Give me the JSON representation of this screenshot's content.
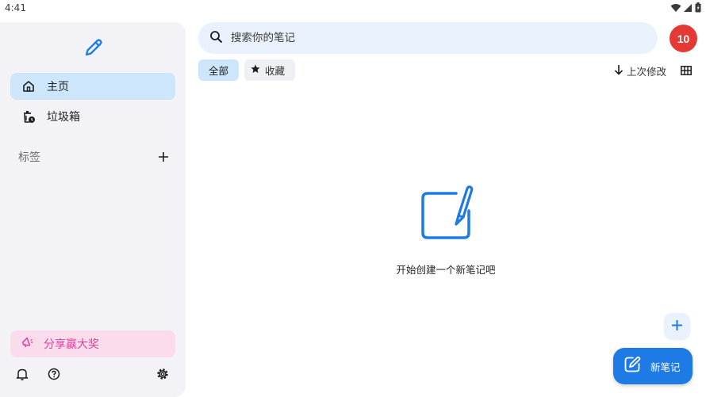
{
  "status_bar": {
    "time": "4:41"
  },
  "sidebar": {
    "nav": [
      {
        "label": "主页",
        "icon": "home-icon",
        "active": true
      },
      {
        "label": "垃圾箱",
        "icon": "trash-icon",
        "active": false
      }
    ],
    "tags_label": "标签",
    "promo_label": "分享赢大奖",
    "bottom_icons": [
      "bell-icon",
      "help-icon",
      "gear-icon"
    ]
  },
  "search": {
    "placeholder": "搜索你的笔记"
  },
  "badge": {
    "count": "10"
  },
  "filters": {
    "all_label": "全部",
    "favorites_label": "收藏"
  },
  "sort": {
    "label": "上次修改"
  },
  "empty_state": {
    "text": "开始创建一个新笔记吧"
  },
  "fab": {
    "new_note_label": "新笔记"
  },
  "colors": {
    "accent": "#1e7be6",
    "active_nav": "#cde6fb",
    "badge": "#e53935",
    "promo_bg": "#fadcec",
    "promo_text": "#e0409a",
    "sidebar_bg": "#f2f2f7",
    "search_bg": "#e8f1fc"
  }
}
